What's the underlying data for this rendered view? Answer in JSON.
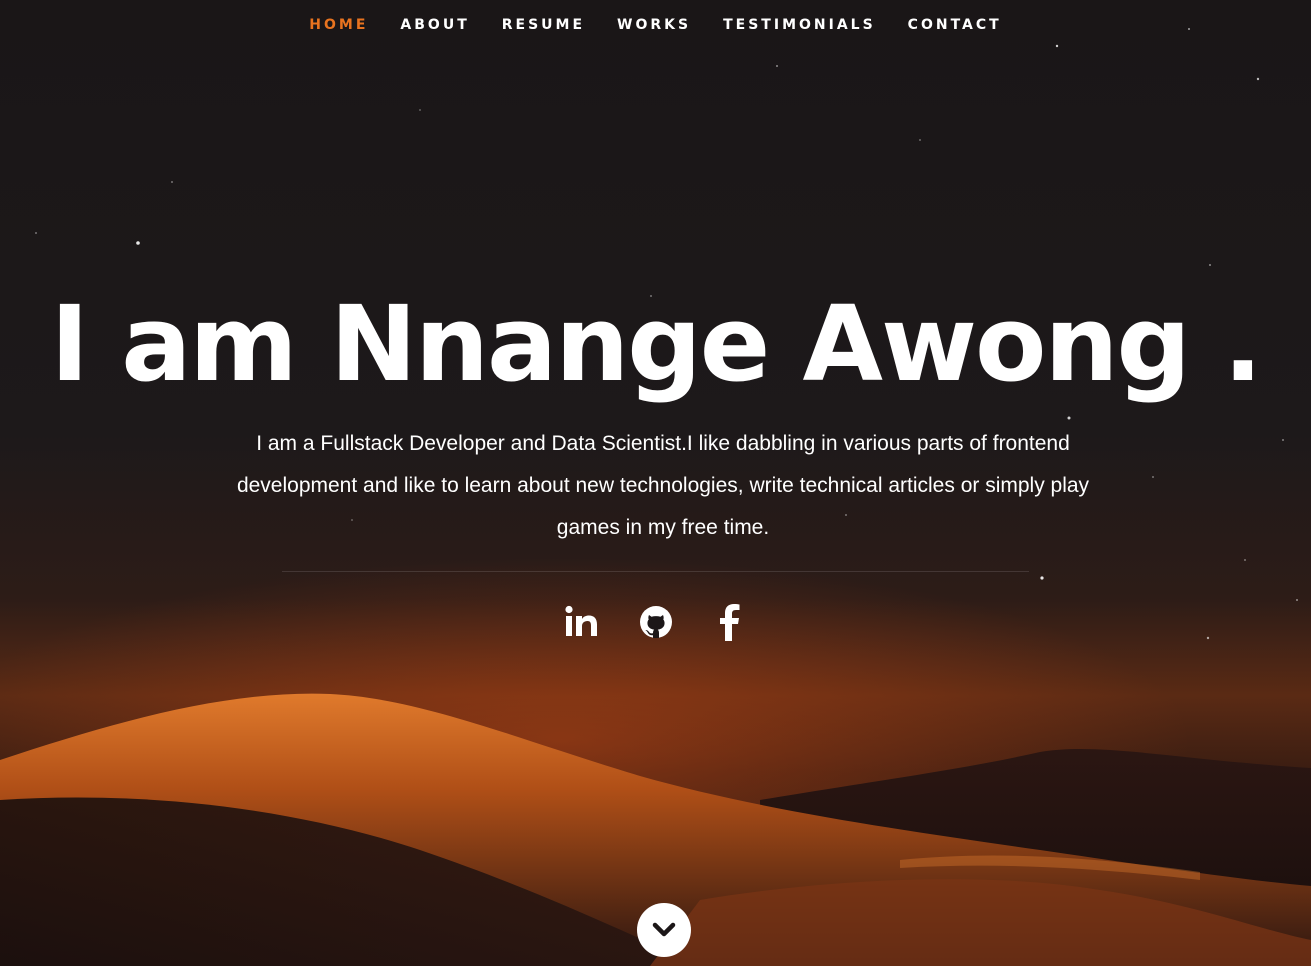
{
  "nav": {
    "items": [
      {
        "label": "HOME",
        "active": true
      },
      {
        "label": "ABOUT",
        "active": false
      },
      {
        "label": "RESUME",
        "active": false
      },
      {
        "label": "WORKS",
        "active": false
      },
      {
        "label": "TESTIMONIALS",
        "active": false
      },
      {
        "label": "CONTACT",
        "active": false
      }
    ],
    "active_color": "#e8731f",
    "text_color": "#ffffff"
  },
  "hero": {
    "headline": "I am Nnange Awong .",
    "bio": "I am a Fullstack Developer and Data Scientist.I like dabbling in various parts of frontend development and like to learn about new technologies, write technical articles or simply play games in my free time."
  },
  "social": [
    {
      "icon": "linkedin-icon"
    },
    {
      "icon": "github-icon"
    },
    {
      "icon": "facebook-icon"
    }
  ],
  "scroll_button": {
    "icon": "chevron-down-icon"
  }
}
